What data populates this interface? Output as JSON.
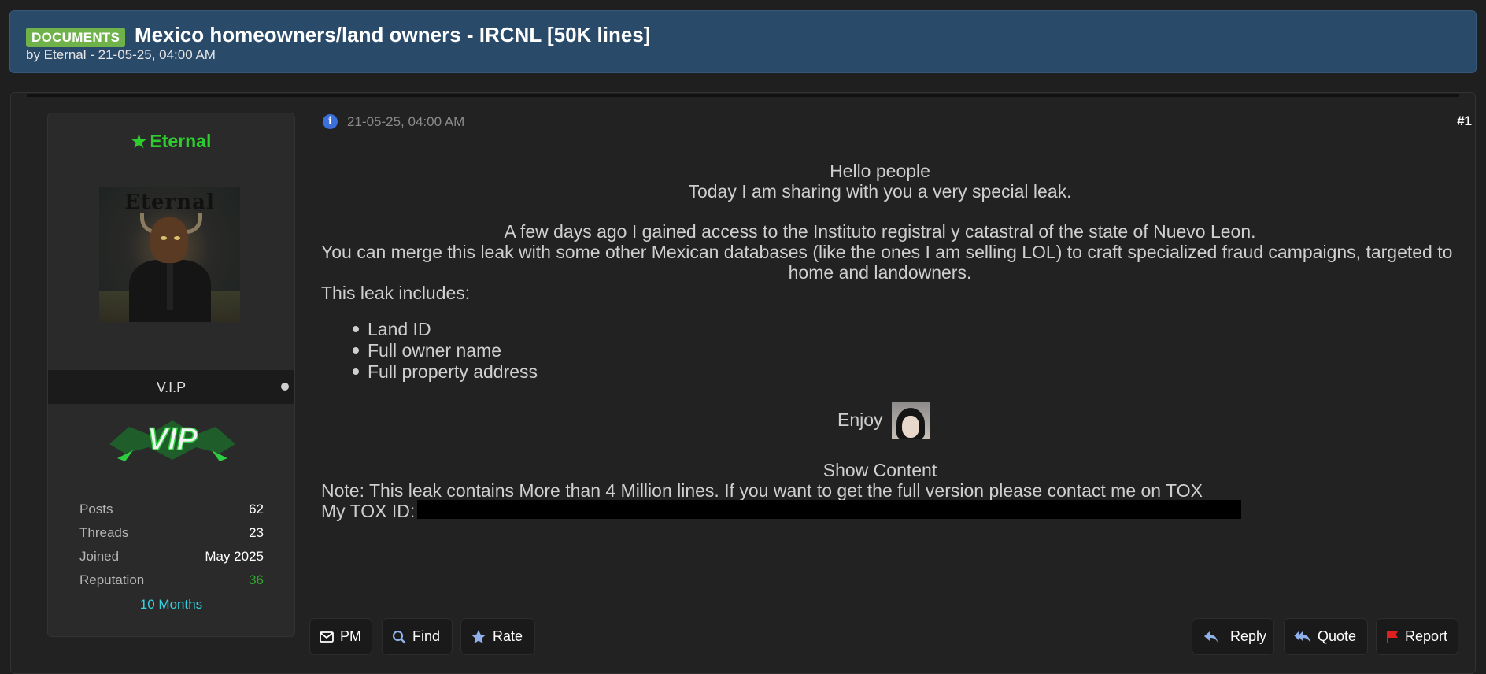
{
  "thread": {
    "prefix": "DOCUMENTS",
    "title": "Mexico homeowners/land owners - IRCNL [50K lines]",
    "meta": "by Eternal - 21-05-25, 04:00 AM"
  },
  "user": {
    "name": "Eternal",
    "name_color": "#2ecc2e",
    "avatar_text": "Eternal",
    "rank": "V.I.P",
    "badge_text": "VIP",
    "stats": [
      {
        "label": "Posts",
        "value": "62"
      },
      {
        "label": "Threads",
        "value": "23"
      },
      {
        "label": "Joined",
        "value": "May 2025"
      },
      {
        "label": "Reputation",
        "value": "36"
      }
    ],
    "tenure": "10 Months"
  },
  "post": {
    "date": "21-05-25, 04:00 AM",
    "number": "#1",
    "greeting": "Hello people",
    "intro": "Today I am sharing with you a very special leak.",
    "para1": "A few days ago I gained access to the Instituto registral y catastral of the state of Nuevo Leon.",
    "para2_line1": "You can merge this leak with some other Mexican databases (like the ones I am selling LOL) to craft specialized fraud campaigns, targeted to",
    "para2_line2": "home and landowners.",
    "includes": "This leak includes:",
    "items": [
      "Land ID",
      "Full owner name",
      "Full property address"
    ],
    "enjoy": "Enjoy",
    "show_content": "Show Content",
    "note": "Note: This leak contains More than 4 Million lines. If you want to get the full version please contact me on TOX",
    "tox_label": "My TOX ID:"
  },
  "actions": {
    "pm": "PM",
    "find": "Find",
    "rate": "Rate",
    "reply": "Reply",
    "quote": "Quote",
    "report": "Report"
  },
  "icons": {
    "info": "info-icon",
    "star": "star-icon",
    "pm": "envelope-icon",
    "find": "search-icon",
    "rate": "star-icon",
    "reply": "reply-icon",
    "quote": "quote-icon",
    "report": "flag-icon"
  }
}
